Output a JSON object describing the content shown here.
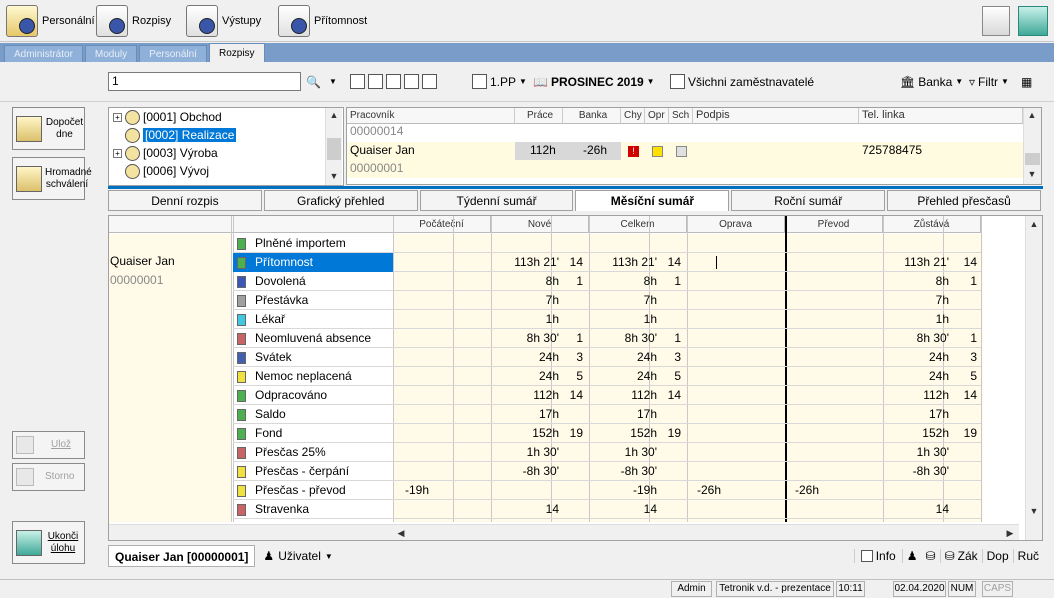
{
  "top": {
    "buttons": [
      {
        "label": "Personální",
        "icon": "personnel-icon"
      },
      {
        "label": "Rozpisy",
        "icon": "schedules-icon"
      },
      {
        "label": "Výstupy",
        "icon": "outputs-icon"
      },
      {
        "label": "Přítomnost",
        "icon": "presence-icon"
      }
    ]
  },
  "tabs": [
    "Administrátor",
    "Moduly",
    "Personální",
    "Rozpisy"
  ],
  "toolbar": {
    "search_value": "1",
    "period": "1.PP",
    "month": "PROSINEC 2019",
    "employers": "Všichni zaměstnavatelé",
    "bank": "Banka",
    "filter": "Filtr"
  },
  "side": {
    "dopocet": "Dopočet dne",
    "hromadne": "Hromadné schválení",
    "uloz": "Ulož",
    "storno": "Storno",
    "ukonci": "Ukonči úlohu"
  },
  "tree": [
    {
      "label": "[0001] Obchod",
      "selected": false,
      "expander": "+"
    },
    {
      "label": "[0002] Realizace",
      "selected": true,
      "expander": ""
    },
    {
      "label": "[0003] Výroba",
      "selected": false,
      "expander": "+"
    },
    {
      "label": "[0006] Vývoj",
      "selected": false,
      "expander": ""
    }
  ],
  "grid1": {
    "headers": [
      "Pracovník",
      "Práce",
      "Banka",
      "Chy",
      "Opr",
      "Sch",
      "Podpis",
      "Tel. linka"
    ],
    "rows": [
      {
        "name": "00000014",
        "prace": "",
        "banka": "",
        "tel": ""
      },
      {
        "name": "Quaiser Jan",
        "prace": "112h",
        "banka": "-26h",
        "tel": "725788475"
      },
      {
        "name": "00000001",
        "prace": "",
        "banka": "",
        "tel": ""
      }
    ]
  },
  "subtabs": [
    "Denní rozpis",
    "Grafický přehled",
    "Týdenní sumář",
    "Měsíční sumář",
    "Roční sumář",
    "Přehled přesčasů"
  ],
  "summary": {
    "employee_name": "Quaiser Jan",
    "employee_id": "00000001",
    "col_headers": [
      "Počáteční",
      "Nové",
      "Celkem",
      "Oprava",
      "Převod",
      "Zůstává"
    ],
    "rows": [
      {
        "label": "Plněné importem",
        "color": "#4caf50",
        "poc": "",
        "nove_h": "",
        "nove_n": "",
        "cel_h": "",
        "cel_n": "",
        "opr": "",
        "pre": "",
        "zus_h": "",
        "zus_n": ""
      },
      {
        "label": "Přítomnost",
        "color": "#4caf50",
        "poc": "",
        "nove_h": "113h 21'",
        "nove_n": "14",
        "cel_h": "113h 21'",
        "cel_n": "14",
        "opr": "",
        "pre": "",
        "zus_h": "113h 21'",
        "zus_n": "14"
      },
      {
        "label": "Dovolená",
        "color": "#3a56b8",
        "poc": "",
        "nove_h": "8h",
        "nove_n": "1",
        "cel_h": "8h",
        "cel_n": "1",
        "opr": "",
        "pre": "",
        "zus_h": "8h",
        "zus_n": "1"
      },
      {
        "label": "Přestávka",
        "color": "#a0a0a0",
        "poc": "",
        "nove_h": "7h",
        "nove_n": "",
        "cel_h": "7h",
        "cel_n": "",
        "opr": "",
        "pre": "",
        "zus_h": "7h",
        "zus_n": ""
      },
      {
        "label": "Lékař",
        "color": "#40c8e0",
        "poc": "",
        "nove_h": "1h",
        "nove_n": "",
        "cel_h": "1h",
        "cel_n": "",
        "opr": "",
        "pre": "",
        "zus_h": "1h",
        "zus_n": ""
      },
      {
        "label": "Neomluvená absence",
        "color": "#c86464",
        "poc": "",
        "nove_h": "8h 30'",
        "nove_n": "1",
        "cel_h": "8h 30'",
        "cel_n": "1",
        "opr": "",
        "pre": "",
        "zus_h": "8h 30'",
        "zus_n": "1"
      },
      {
        "label": "Svátek",
        "color": "#4060b0",
        "poc": "",
        "nove_h": "24h",
        "nove_n": "3",
        "cel_h": "24h",
        "cel_n": "3",
        "opr": "",
        "pre": "",
        "zus_h": "24h",
        "zus_n": "3"
      },
      {
        "label": "Nemoc neplacená",
        "color": "#f0e040",
        "poc": "",
        "nove_h": "24h",
        "nove_n": "5",
        "cel_h": "24h",
        "cel_n": "5",
        "opr": "",
        "pre": "",
        "zus_h": "24h",
        "zus_n": "5"
      },
      {
        "label": "Odpracováno",
        "color": "#4caf50",
        "poc": "",
        "nove_h": "112h",
        "nove_n": "14",
        "cel_h": "112h",
        "cel_n": "14",
        "opr": "",
        "pre": "",
        "zus_h": "112h",
        "zus_n": "14"
      },
      {
        "label": "Saldo",
        "color": "#4caf50",
        "poc": "",
        "nove_h": "17h",
        "nove_n": "",
        "cel_h": "17h",
        "cel_n": "",
        "opr": "",
        "pre": "",
        "zus_h": "17h",
        "zus_n": ""
      },
      {
        "label": "Fond",
        "color": "#4caf50",
        "poc": "",
        "nove_h": "152h",
        "nove_n": "19",
        "cel_h": "152h",
        "cel_n": "19",
        "opr": "",
        "pre": "",
        "zus_h": "152h",
        "zus_n": "19"
      },
      {
        "label": "Přesčas 25%",
        "color": "#c86464",
        "poc": "",
        "nove_h": "1h 30'",
        "nove_n": "",
        "cel_h": "1h 30'",
        "cel_n": "",
        "opr": "",
        "pre": "",
        "zus_h": "1h 30'",
        "zus_n": ""
      },
      {
        "label": "Přesčas - čerpání",
        "color": "#f0e040",
        "poc": "",
        "nove_h": "-8h 30'",
        "nove_n": "",
        "cel_h": "-8h 30'",
        "cel_n": "",
        "opr": "",
        "pre": "",
        "zus_h": "-8h 30'",
        "zus_n": ""
      },
      {
        "label": "Přesčas - převod",
        "color": "#f0e040",
        "poc": "-19h",
        "nove_h": "",
        "nove_n": "",
        "cel_h": "-19h",
        "cel_n": "",
        "opr": "-26h",
        "pre": "-26h",
        "zus_h": "",
        "zus_n": ""
      },
      {
        "label": "Stravenka",
        "color": "#c86464",
        "poc": "",
        "nove_h": "14",
        "nove_n": "",
        "cel_h": "14",
        "cel_n": "",
        "opr": "",
        "pre": "",
        "zus_h": "14",
        "zus_n": ""
      }
    ]
  },
  "bottom": {
    "employee": "Quaiser Jan [00000001]",
    "user": "Uživatel",
    "info": "Info",
    "zak": "Zák",
    "dop": "Dop",
    "ruc": "Ruč"
  },
  "status": {
    "user": "Admin",
    "company": "Tetronik v.d. - prezentace",
    "time": "10:11",
    "date": "02.04.2020",
    "num": "NUM",
    "caps": "CAPS"
  }
}
